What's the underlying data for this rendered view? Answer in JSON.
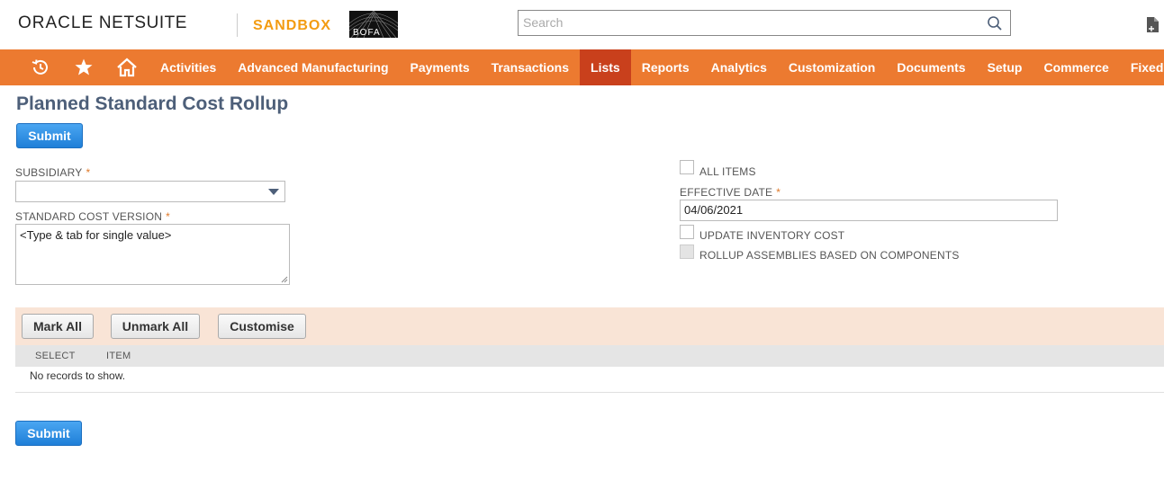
{
  "header": {
    "logo_brand": "ORACLE",
    "logo_product": "NETSUITE",
    "environment": "SANDBOX",
    "account_logo": "BOFA",
    "search_placeholder": "Search"
  },
  "nav": {
    "items": [
      {
        "label": "Activities"
      },
      {
        "label": "Advanced Manufacturing"
      },
      {
        "label": "Payments"
      },
      {
        "label": "Transactions"
      },
      {
        "label": "Lists",
        "active": true
      },
      {
        "label": "Reports"
      },
      {
        "label": "Analytics"
      },
      {
        "label": "Customization"
      },
      {
        "label": "Documents"
      },
      {
        "label": "Setup"
      },
      {
        "label": "Commerce"
      },
      {
        "label": "Fixed"
      }
    ]
  },
  "page": {
    "title": "Planned Standard Cost Rollup",
    "submit_label": "Submit"
  },
  "form": {
    "subsidiary_label": "SUBSIDIARY",
    "subsidiary_value": "",
    "std_cost_version_label": "STANDARD COST VERSION",
    "std_cost_version_value": "<Type & tab for single value>",
    "all_items_label": "ALL ITEMS",
    "effective_date_label": "EFFECTIVE DATE",
    "effective_date_value": "04/06/2021",
    "update_inventory_label": "UPDATE INVENTORY COST",
    "rollup_assemblies_label": "ROLLUP ASSEMBLIES BASED ON COMPONENTS",
    "required_mark": "*"
  },
  "sublist": {
    "mark_all": "Mark All",
    "unmark_all": "Unmark All",
    "customise": "Customise",
    "columns": [
      "SELECT",
      "ITEM"
    ],
    "empty_text": "No records to show."
  },
  "colors": {
    "nav_bg": "#ec7a30",
    "nav_active": "#c9401c",
    "title": "#4d5f79",
    "primary_button": "#2a8ee8",
    "sandbox": "#f39c12",
    "sublist_bar": "#f9e4d6"
  },
  "icons": [
    "recent-records-icon",
    "favorites-star-icon",
    "home-icon",
    "search-icon",
    "document-icon",
    "dropdown-arrow-icon"
  ]
}
